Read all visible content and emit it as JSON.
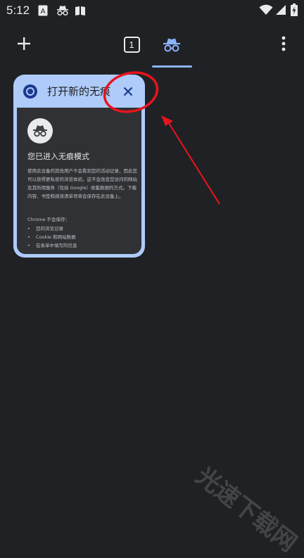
{
  "status_bar": {
    "time": "5:12",
    "left_icons": [
      "translate-icon",
      "incognito-icon",
      "book-icon"
    ],
    "right_icons": [
      "wifi-icon",
      "signal-icon",
      "battery-icon"
    ]
  },
  "toolbar": {
    "new_tab_icon": "plus-icon",
    "tab_count": "1",
    "incognito_tab_icon": "incognito-icon",
    "menu_icon": "more-vert-icon"
  },
  "tab_card": {
    "title": "打开新的无痕",
    "favicon": "chrome-icon",
    "close_icon": "close-icon",
    "preview": {
      "heading": "您已进入无痕模式",
      "body": "使用此设备的其他用户不会看到您的活动记录，因此您可以获得更私密的浏览体验。这不会改变您访问的网站及其所用服务（包括 Google）收集数据的方式。下载内容、书签和阅读清单项将会保存在此设备上。",
      "sub": "Chrome 不会保存：",
      "list": [
        "您的浏览记录",
        "Cookie 和网站数据",
        "在表单中填写的信息"
      ]
    }
  },
  "annotation": {
    "color": "#e8141e"
  },
  "watermark": "光速下载网",
  "colors": {
    "background": "#202124",
    "card": "#aecbfa",
    "accent": "#8ab4f8"
  }
}
